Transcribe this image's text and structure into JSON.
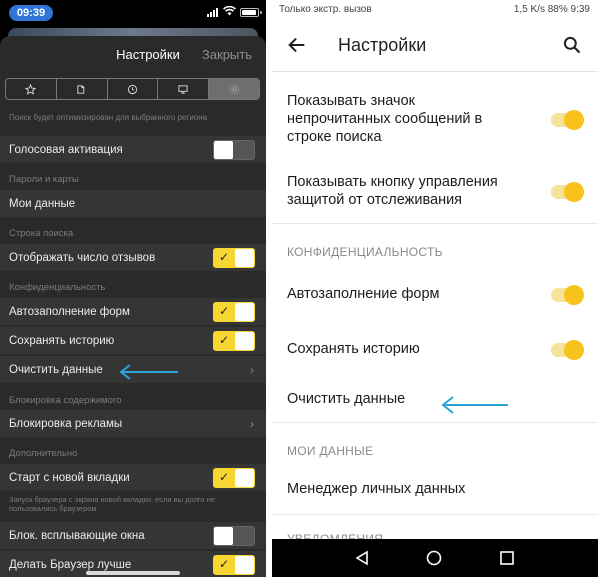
{
  "left": {
    "status_time": "09:39",
    "header": {
      "title": "Настройки",
      "close_label": "Закрыть"
    },
    "tabs": [
      "star-icon",
      "book-icon",
      "clock-icon",
      "monitor-icon",
      "gear-icon"
    ],
    "region_hint": "Поиск будет оптимизирован для выбранного региона",
    "voice_activation": {
      "label": "Голосовая активация",
      "on": false
    },
    "section_passwords": "Пароли и карты",
    "my_data": "Мои данные",
    "section_search": "Строка поиска",
    "show_reviews": {
      "label": "Отображать число отзывов",
      "on": true
    },
    "section_privacy": "Конфиденциальность",
    "autofill": {
      "label": "Автозаполнение форм",
      "on": true
    },
    "save_history": {
      "label": "Сохранять историю",
      "on": true
    },
    "clear_data": "Очистить данные",
    "section_blocking": "Блокировка содержимого",
    "ad_block": "Блокировка рекламы",
    "section_additional": "Дополнительно",
    "new_tab_start": {
      "label": "Старт с новой вкладки",
      "on": true
    },
    "new_tab_hint": "Запуск браузера с экрана новой вкладки, если вы долго не пользовались браузером",
    "block_popups": {
      "label": "Блок. всплывающие окна",
      "on": false
    },
    "make_better": {
      "label": "Делать Браузер лучше",
      "on": true
    }
  },
  "right": {
    "status_left": "Только экстр. вызов",
    "status_right": "1,5 K/s  88%  9:39",
    "title": "Настройки",
    "unread_badge": {
      "label": "Показывать значок непрочитанных сообщений в строке поиска",
      "on": true
    },
    "tracking_button": {
      "label": "Показывать кнопку управления защитой от отслеживания",
      "on": true
    },
    "section_privacy": "КОНФИДЕНЦИАЛЬНОСТЬ",
    "autofill": {
      "label": "Автозаполнение форм",
      "on": true
    },
    "save_history": {
      "label": "Сохранять историю",
      "on": true
    },
    "clear_data": "Очистить данные",
    "section_my_data": "МОИ ДАННЫЕ",
    "personal_data_manager": "Менеджер личных данных",
    "section_notifications": "УВЕДОМЛЕНИЯ"
  },
  "colors": {
    "ios_toggle_on": "#f5d632",
    "android_switch_thumb": "#f7c21b",
    "android_switch_track": "#f6e39a",
    "annotation_arrow": "#2aa3d6",
    "ios_sheet": "#2a2a2a",
    "ios_row": "#353535"
  }
}
